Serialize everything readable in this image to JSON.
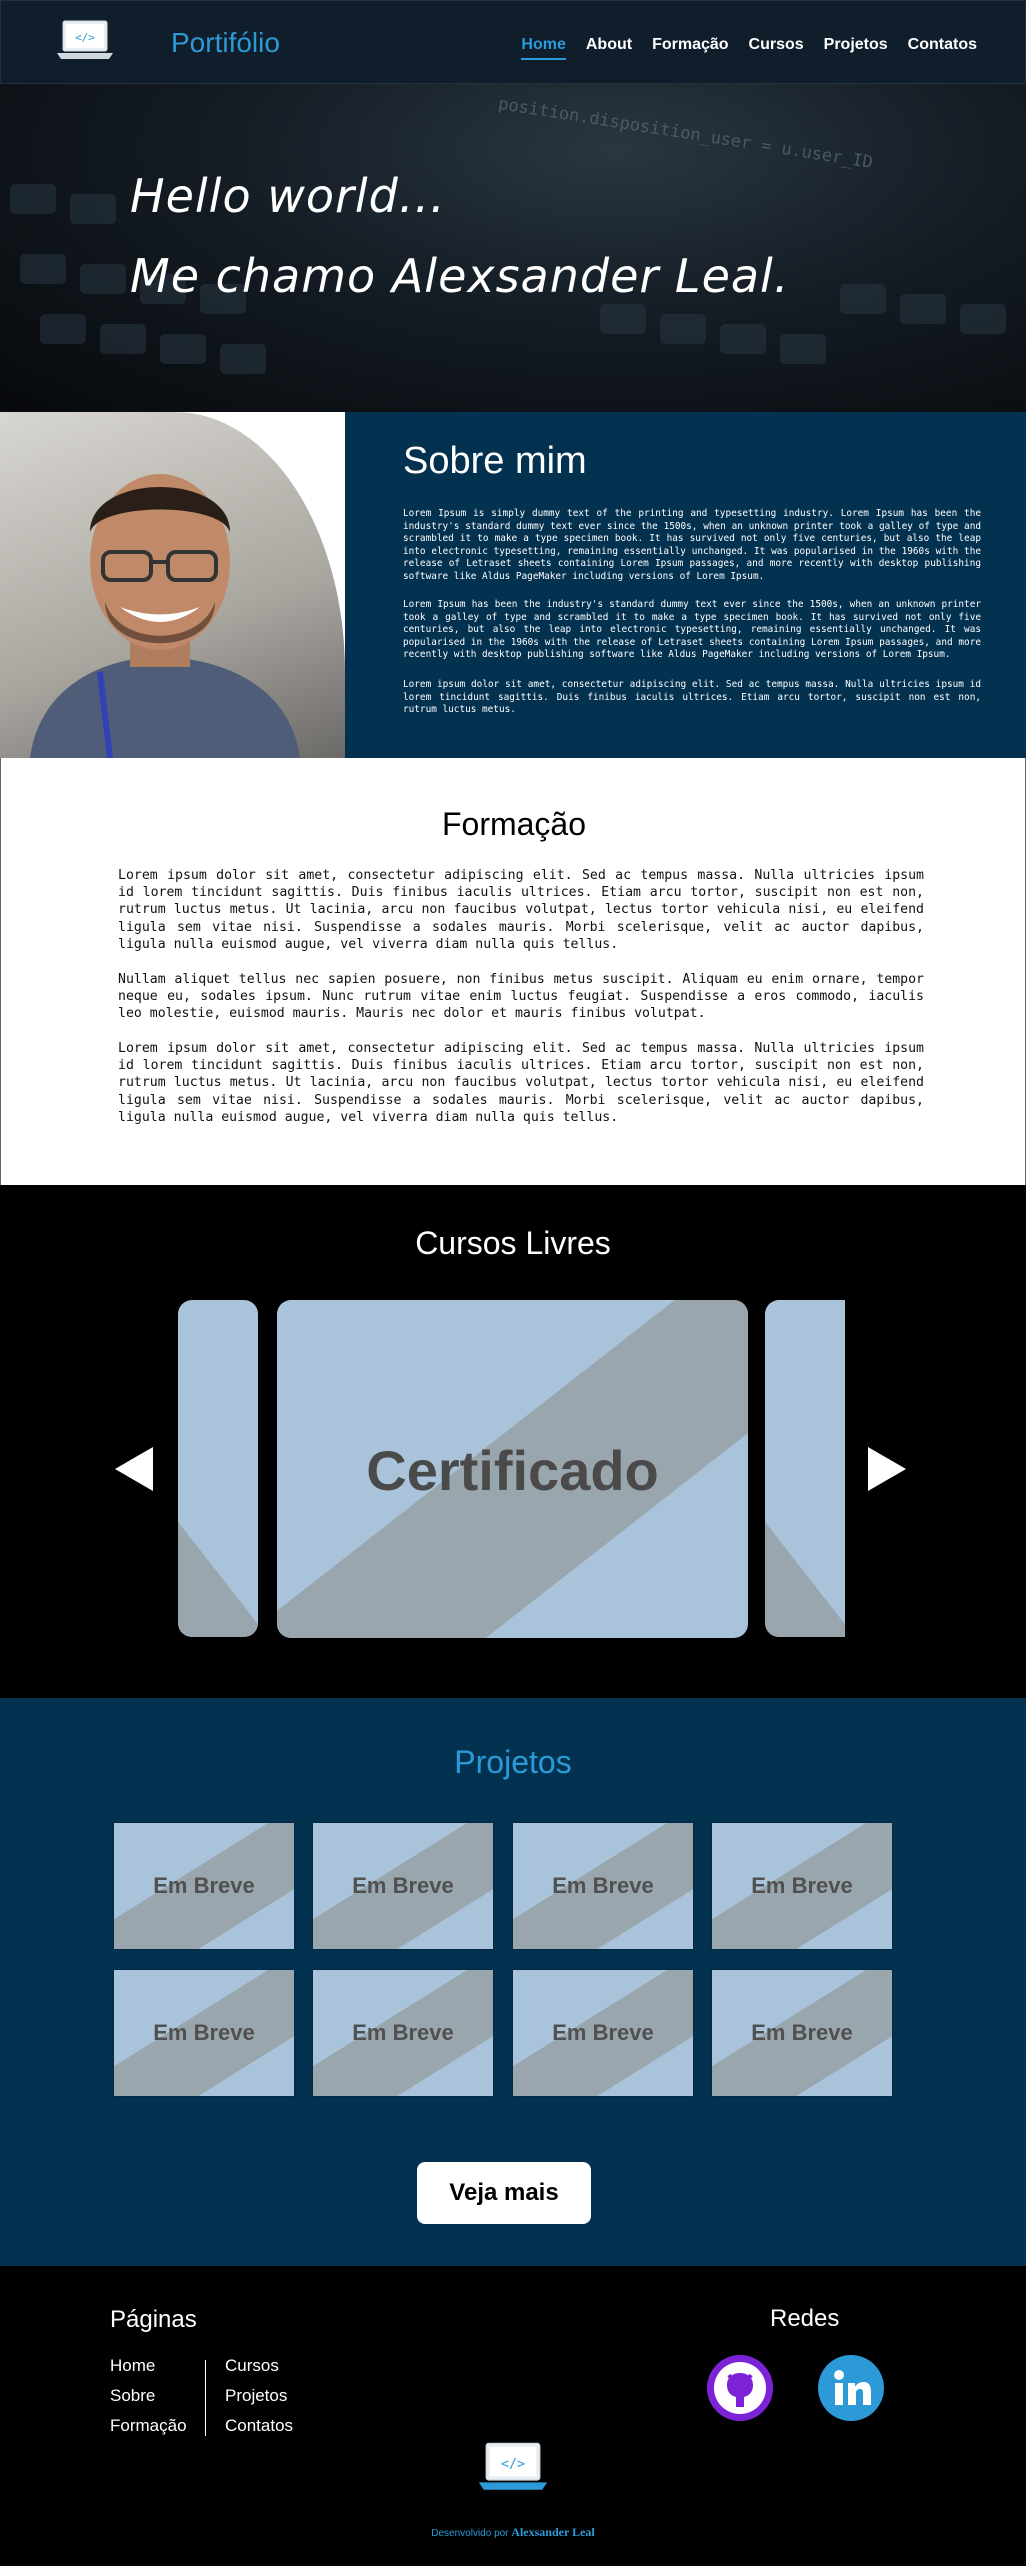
{
  "nav": {
    "brand": "Portifólio",
    "items": [
      "Home",
      "About",
      "Formação",
      "Cursos",
      "Projetos",
      "Contatos"
    ],
    "active": "Home"
  },
  "hero": {
    "line1": "Hello world...",
    "line2": "Me chamo Alexsander Leal.",
    "code_bg": "position.disposition_user = u.user_ID"
  },
  "about": {
    "title": "Sobre mim",
    "paragraphs": [
      "Lorem Ipsum is simply dummy text of the printing and typesetting industry. Lorem Ipsum has been the industry's standard dummy text ever since the 1500s, when an unknown printer took a galley of type and scrambled it to make a type specimen book. It has survived not only five centuries, but also the leap into electronic typesetting, remaining essentially unchanged. It was popularised in the 1960s with the release of Letraset sheets containing Lorem Ipsum passages, and more recently with desktop publishing software like Aldus PageMaker including versions of Lorem Ipsum.",
      "Lorem Ipsum has been the industry's standard dummy text ever since the 1500s, when an unknown printer took a galley of type and scrambled it to make a type specimen book. It has survived not only five centuries, but also the leap into electronic typesetting, remaining essentially unchanged. It was popularised in the 1960s with the release of Letraset sheets containing Lorem Ipsum passages, and more recently with desktop publishing software like Aldus PageMaker including versions of Lorem Ipsum.",
      "Lorem ipsum dolor sit amet, consectetur adipiscing elit. Sed ac tempus massa. Nulla ultricies ipsum id lorem tincidunt sagittis. Duis finibus iaculis ultrices. Etiam arcu tortor, suscipit non est non, rutrum luctus metus."
    ]
  },
  "formacao": {
    "title": "Formação",
    "paragraphs": [
      "Lorem ipsum dolor sit amet, consectetur adipiscing elit. Sed ac tempus massa. Nulla ultricies ipsum id lorem tincidunt sagittis. Duis finibus iaculis ultrices. Etiam arcu tortor, suscipit non est non, rutrum luctus metus. Ut lacinia, arcu non faucibus volutpat, lectus tortor vehicula nisi, eu eleifend ligula sem vitae nisi. Suspendisse a sodales mauris. Morbi scelerisque, velit ac auctor dapibus, ligula nulla euismod augue, vel viverra diam nulla quis tellus.",
      "Nullam aliquet tellus nec sapien posuere, non finibus metus suscipit. Aliquam eu enim ornare, tempor neque eu, sodales ipsum. Nunc rutrum vitae enim luctus feugiat. Suspendisse a eros commodo, iaculis leo molestie, euismod mauris. Mauris nec dolor et mauris finibus volutpat.",
      "Lorem ipsum dolor sit amet, consectetur adipiscing elit. Sed ac tempus massa. Nulla ultricies ipsum id lorem tincidunt sagittis. Duis finibus iaculis ultrices. Etiam arcu tortor, suscipit non est non, rutrum luctus metus. Ut lacinia, arcu non faucibus volutpat, lectus tortor vehicula nisi, eu eleifend ligula sem vitae nisi. Suspendisse a sodales mauris. Morbi scelerisque, velit ac auctor dapibus, ligula nulla euismod augue, vel viverra diam nulla quis tellus."
    ]
  },
  "cursos": {
    "title": "Cursos Livres",
    "card_label": "Certificado",
    "prev_icon": "triangle-left-icon",
    "next_icon": "triangle-right-icon"
  },
  "projetos": {
    "title": "Projetos",
    "cards": [
      "Em Breve",
      "Em Breve",
      "Em Breve",
      "Em Breve",
      "Em Breve",
      "Em Breve",
      "Em Breve",
      "Em Breve"
    ],
    "more_button": "Veja mais"
  },
  "footer": {
    "pages_title": "Páginas",
    "pages_col1": [
      "Home",
      "Sobre",
      "Formação"
    ],
    "pages_col2": [
      "Cursos",
      "Projetos",
      "Contatos"
    ],
    "social_title": "Redes",
    "social": [
      "github-icon",
      "linkedin-icon"
    ],
    "credit_prefix": "Desenvolvido por",
    "credit_name": "Alexsander Leal"
  },
  "colors": {
    "accent": "#2d9ad8",
    "navy": "#033251",
    "card": "#a9c4da",
    "github": "#7c23d8"
  }
}
